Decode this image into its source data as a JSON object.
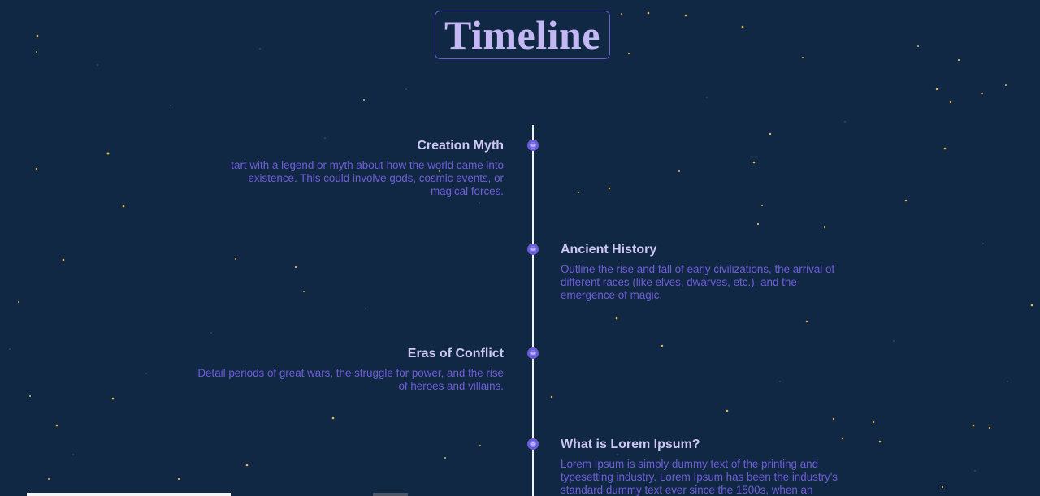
{
  "header": {
    "title": "Timeline"
  },
  "events": [
    {
      "title": "Creation Myth",
      "description": "tart with a legend or myth about how the world came into existence. This could involve gods, cosmic events, or magical forces."
    },
    {
      "title": "Ancient History",
      "description": "Outline the rise and fall of early civilizations, the arrival of different races (like elves, dwarves, etc.), and the emergence of magic."
    },
    {
      "title": "Eras of Conflict",
      "description": "Detail periods of great wars, the struggle for power, and the rise of heroes and villains."
    },
    {
      "title": "What is Lorem Ipsum?",
      "description": "Lorem Ipsum is simply dummy text of the printing and typesetting industry. Lorem Ipsum has been the industry's standard dummy text ever since the 1500s, when an"
    }
  ],
  "colors": {
    "background": "#112844",
    "title": "#c4b8f4",
    "accent": "#6f5ed8",
    "star": "#e8b94a",
    "line": "#f2f2f7"
  }
}
